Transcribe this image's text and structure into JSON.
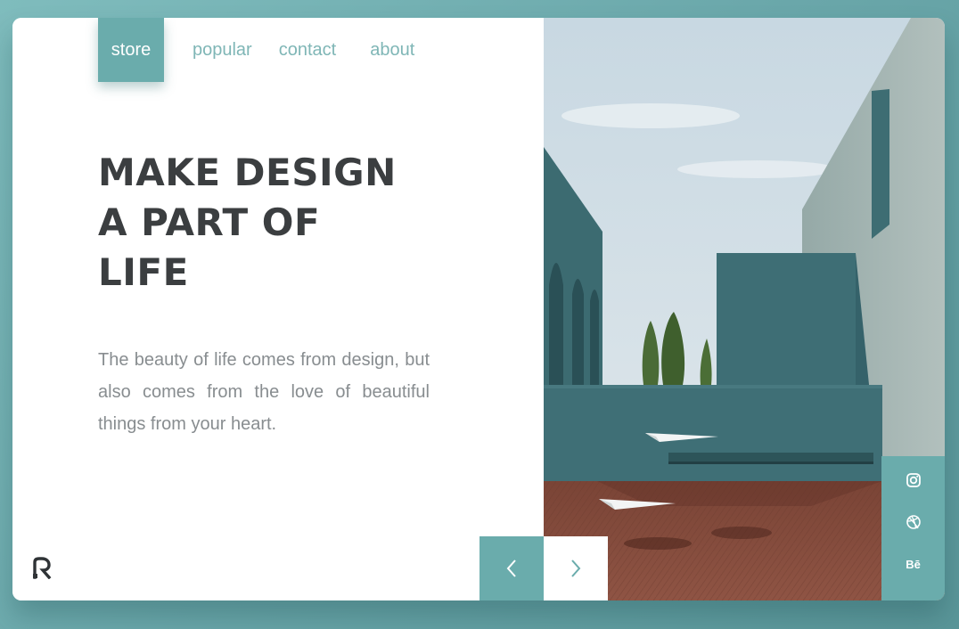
{
  "nav": {
    "store": "store",
    "popular": "popular",
    "contact": "contact",
    "about": "about"
  },
  "hero": {
    "line1_a": "MAKE ",
    "line1_b": "DESIGN",
    "line2": "A PART OF",
    "line3": "LIFE",
    "description": "The beauty of life comes from design, but also comes from the love of beautiful things from your heart."
  },
  "social": {
    "behance": "Bē"
  },
  "icons": {
    "logo": "r-logo-icon",
    "prev": "chevron-left-icon",
    "next": "chevron-right-icon",
    "instagram": "instagram-icon",
    "dribbble": "dribbble-icon",
    "behance": "behance-icon"
  },
  "colors": {
    "accent": "#6aacac",
    "heading": "#3b3e40",
    "body_text": "#888d90",
    "nav_text": "#7fb6b6"
  }
}
